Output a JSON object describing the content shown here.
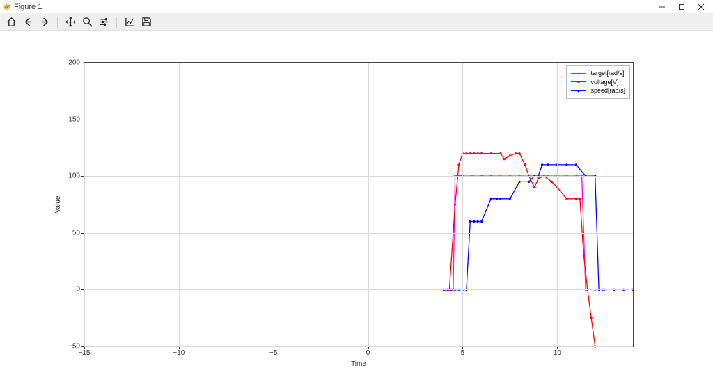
{
  "window": {
    "title": "Figure 1",
    "minimize_tip": "Minimize",
    "maximize_tip": "Maximize",
    "close_tip": "Close"
  },
  "toolbar": {
    "home": "Home",
    "back": "Back",
    "forward": "Forward",
    "pan": "Pan",
    "zoom": "Zoom",
    "subplots": "Configure subplots",
    "axes": "Edit axis",
    "save": "Save"
  },
  "chart": {
    "xlabel": "Time",
    "ylabel": "Value",
    "xlim": [
      -15,
      14
    ],
    "ylim": [
      -50,
      200
    ],
    "xticks": [
      -15,
      -10,
      -5,
      0,
      5,
      10
    ],
    "yticks": [
      -50,
      0,
      50,
      100,
      150,
      200
    ],
    "legend": {
      "target": "target[rad/s]",
      "voltage": "voltage[V]",
      "speed": "speed[rad/s]"
    },
    "colors": {
      "target": "#ff00ff",
      "voltage": "#ff0000",
      "speed": "#0000ff",
      "grid": "#d9d9d9",
      "axes": "#444"
    }
  },
  "chart_data": {
    "type": "line",
    "xlabel": "Time",
    "ylabel": "Value",
    "xlim": [
      -15,
      14
    ],
    "ylim": [
      -50,
      200
    ],
    "series": [
      {
        "name": "target[rad/s]",
        "color": "#ff00ff",
        "x": [
          4.0,
          4.1,
          4.2,
          4.3,
          4.4,
          4.5,
          4.6,
          4.7,
          4.8,
          4.9,
          5.0,
          5.5,
          6.0,
          6.5,
          7.0,
          7.5,
          8.0,
          8.5,
          9.0,
          9.5,
          10.0,
          10.5,
          11.0,
          11.3,
          11.5,
          12.0,
          12.5,
          13.0,
          13.5,
          14.0
        ],
        "y": [
          0,
          0,
          0,
          0,
          0,
          0,
          100,
          100,
          100,
          100,
          100,
          100,
          100,
          100,
          100,
          100,
          100,
          100,
          100,
          100,
          100,
          100,
          100,
          100,
          0,
          0,
          0,
          0,
          0,
          0
        ]
      },
      {
        "name": "voltage[V]",
        "color": "#ff0000",
        "x": [
          4.0,
          4.3,
          4.6,
          4.8,
          5.0,
          5.2,
          5.4,
          5.6,
          5.8,
          6.0,
          6.5,
          7.0,
          7.2,
          7.5,
          7.8,
          8.0,
          8.3,
          8.5,
          8.8,
          9.0,
          9.3,
          9.7,
          10.0,
          10.5,
          11.0,
          11.2,
          11.4,
          11.6,
          11.8,
          12.0
        ],
        "y": [
          0,
          0,
          75,
          110,
          120,
          120,
          120,
          120,
          120,
          120,
          120,
          120,
          115,
          118,
          120,
          120,
          110,
          100,
          90,
          98,
          100,
          95,
          90,
          80,
          80,
          80,
          30,
          0,
          -25,
          -50
        ]
      },
      {
        "name": "speed[rad/s]",
        "color": "#0000ff",
        "x": [
          4.0,
          4.2,
          4.4,
          4.6,
          4.8,
          5.0,
          5.2,
          5.4,
          5.6,
          5.8,
          6.0,
          6.5,
          6.8,
          7.0,
          7.5,
          8.0,
          8.5,
          8.8,
          9.0,
          9.2,
          9.5,
          10.0,
          10.5,
          11.0,
          11.5,
          12.0,
          12.2,
          12.4,
          13.0,
          13.5,
          14.0
        ],
        "y": [
          0,
          0,
          0,
          0,
          0,
          0,
          0,
          60,
          60,
          60,
          60,
          80,
          80,
          80,
          80,
          95,
          95,
          100,
          100,
          110,
          110,
          110,
          110,
          110,
          100,
          100,
          0,
          0,
          0,
          0,
          0
        ]
      }
    ]
  }
}
